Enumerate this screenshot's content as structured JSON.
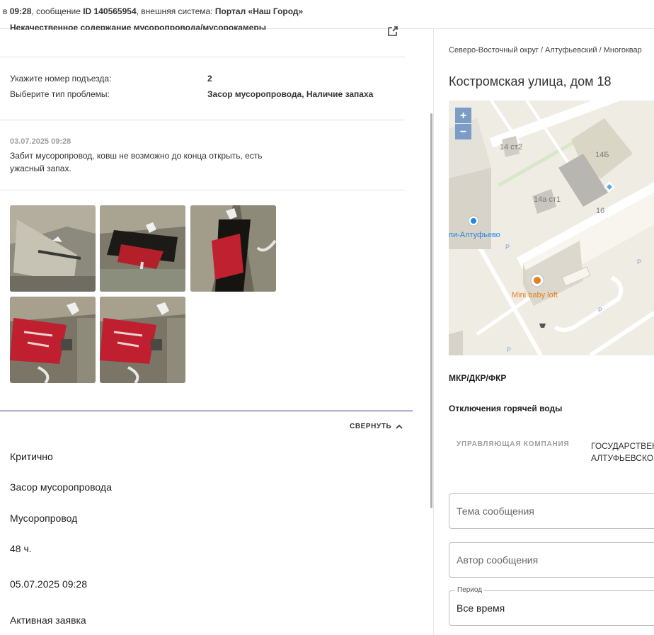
{
  "header": {
    "prefix": "в",
    "time": "09:28",
    "msg_label": ", сообщение",
    "msg_id": "ID 140565954",
    "ext_label": ", внешняя система:",
    "ext_system": "Портал «Наш Город»"
  },
  "ticket": {
    "category": "Некачественное содержание мусоропровода/мусорокамеры",
    "params": [
      {
        "label": "Укажите номер подъезда:",
        "value": "2"
      },
      {
        "label": "Выберите тип проблемы:",
        "value": "Засор мусоропровода, Наличие запаха"
      }
    ],
    "message": {
      "date": "03.07.2025 09:28",
      "text": "Забит мусоропровод, ковш не возможно до конца открыть, есть ужасный запах."
    },
    "photos_count": 5
  },
  "details": {
    "collapse_label": "СВЕРНУТЬ",
    "priority": "Критично",
    "problem": "Засор мусоропровода",
    "object": "Мусоропровод",
    "deadline": "48 ч.",
    "due_date": "05.07.2025 09:28",
    "status": "Активная заявка"
  },
  "location": {
    "breadcrumb": "Северо-Восточный округ / Алтуфьевский / Многоквар",
    "address": "Костромская улица, дом 18",
    "map_labels": {
      "b1": "14 ст2",
      "b2": "14Б",
      "b3": "14а ст1",
      "b4": "16",
      "poi1": "пи-Алтуфьево",
      "poi2": "Mini baby loft",
      "parking": "P"
    },
    "zoom_in": "+",
    "zoom_out": "−"
  },
  "side": {
    "section1": "МКР/ДКР/ФКР",
    "section2": "Отключения горячей воды",
    "uk_label": "УПРАВЛЯЮЩАЯ КОМПАНИЯ",
    "uk_value_line1": "ГОСУДАРСТВЕН",
    "uk_value_line2": "АЛТУФЬЕВСКОГ"
  },
  "filters": {
    "topic_placeholder": "Тема сообщения",
    "author_placeholder": "Автор сообщения",
    "period_label": "Период",
    "period_value": "Все время"
  },
  "colors": {
    "accent_line": "#283593",
    "zoom_btn": "#7b9cc7",
    "poi_orange": "#e67e22",
    "poi_blue": "#1e88e5"
  }
}
